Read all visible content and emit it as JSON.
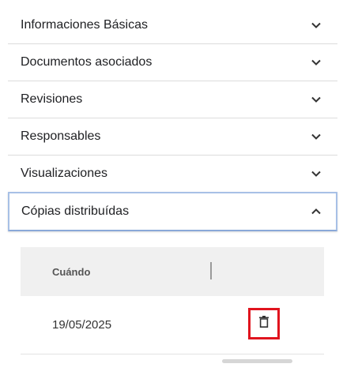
{
  "accordion": {
    "sections": [
      {
        "label": "Informaciones Básicas"
      },
      {
        "label": "Documentos asociados"
      },
      {
        "label": "Revisiones"
      },
      {
        "label": "Responsables"
      },
      {
        "label": "Visualizaciones"
      },
      {
        "label": "Cópias distribuídas"
      }
    ]
  },
  "copies_table": {
    "headers": {
      "when": "Cuándo"
    },
    "rows": [
      {
        "date": "19/05/2025",
        "action_icon": "trash-icon"
      }
    ]
  },
  "colors": {
    "highlight_border": "#e0141e",
    "active_border": "#a7c0e6"
  }
}
